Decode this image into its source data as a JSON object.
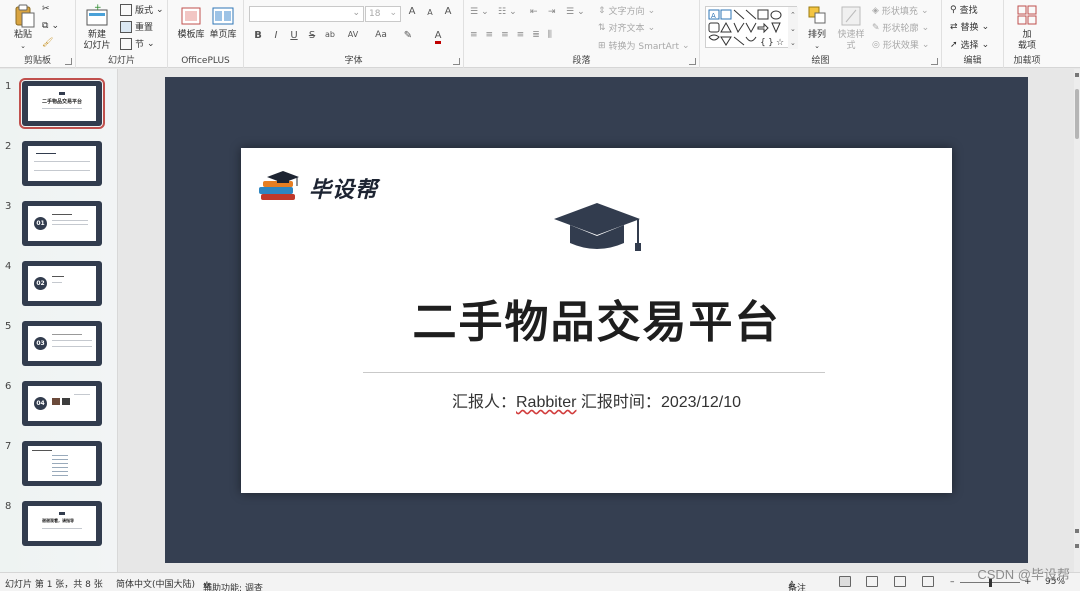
{
  "ribbon": {
    "clipboard": {
      "paste": "粘贴",
      "group": "剪贴板"
    },
    "slides": {
      "new_slide": "新建\n幻灯片",
      "layout": "版式",
      "reset": "重置",
      "section": "节",
      "group": "幻灯片"
    },
    "officeplus": {
      "template": "模板库",
      "single": "单页库",
      "group": "OfficePLUS"
    },
    "font": {
      "font_name": "",
      "font_size": "18",
      "bold": "B",
      "italic": "I",
      "underline": "U",
      "strike": "S",
      "shadow": "ab",
      "spacing": "AV",
      "case": "Aa",
      "grow": "A",
      "shrink": "A",
      "clear": "A",
      "group": "字体"
    },
    "paragraph": {
      "text_direction": "文字方向",
      "align_text": "对齐文本",
      "smartart": "转换为 SmartArt",
      "group": "段落"
    },
    "drawing": {
      "arrange": "排列",
      "quick_styles": "快速样式",
      "shape_fill": "形状填充",
      "shape_outline": "形状轮廓",
      "shape_effects": "形状效果",
      "group": "绘图"
    },
    "editing": {
      "find": "查找",
      "replace": "替换",
      "select": "选择",
      "group": "编辑"
    },
    "addins": {
      "label": "加\n载项",
      "group": "加载项"
    }
  },
  "thumbnails": {
    "numbers": [
      "1",
      "2",
      "3",
      "4",
      "5",
      "6",
      "7",
      "8"
    ],
    "slide1_title": "二手物品交易平台",
    "slide3_num": "01",
    "slide4_num": "02",
    "slide5_num": "03",
    "slide6_num": "04",
    "slide8_title": "谢谢观看，请指导"
  },
  "slide": {
    "logo_text": "毕设帮",
    "title": "二手物品交易平台",
    "reporter_label": "汇报人：",
    "reporter": "Rabbiter",
    "time_label": " 汇报时间：",
    "date": "2023/12/10"
  },
  "status": {
    "slide_info": "幻灯片 第 1 张，共 8 张",
    "language": "简体中文(中国大陆)",
    "accessibility": "辅助功能: 调查",
    "notes": "备注",
    "zoom": "95%"
  },
  "watermark": "CSDN @毕设帮"
}
